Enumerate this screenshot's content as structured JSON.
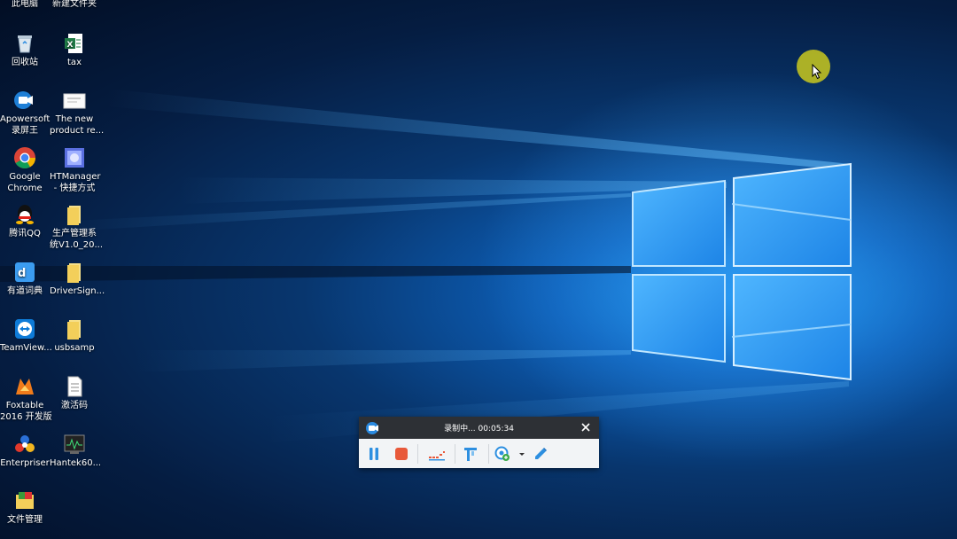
{
  "desktop": {
    "icons": [
      {
        "line1": "此电脑",
        "line2": "",
        "icon": "this-pc-icon"
      },
      {
        "line1": "新建文件夹",
        "line2": "",
        "icon": "folder-icon"
      },
      {
        "line1": "回收站",
        "line2": "",
        "icon": "recycle-bin-icon"
      },
      {
        "line1": "tax",
        "line2": "",
        "icon": "excel-file-icon"
      },
      {
        "line1": "Apowersoft",
        "line2": "录屏王",
        "icon": "apowersoft-icon"
      },
      {
        "line1": "The new",
        "line2": "product re...",
        "icon": "document-icon"
      },
      {
        "line1": "Google",
        "line2": "Chrome",
        "icon": "chrome-icon"
      },
      {
        "line1": "HTManager",
        "line2": "- 快捷方式",
        "icon": "htmanager-icon"
      },
      {
        "line1": "腾讯QQ",
        "line2": "",
        "icon": "qq-icon"
      },
      {
        "line1": "生产管理系",
        "line2": "统V1.0_20...",
        "icon": "folder-icon"
      },
      {
        "line1": "有道词典",
        "line2": "",
        "icon": "youdao-icon"
      },
      {
        "line1": "DriverSign...",
        "line2": "",
        "icon": "folder-icon"
      },
      {
        "line1": "TeamView...",
        "line2": "",
        "icon": "teamviewer-icon"
      },
      {
        "line1": "usbsamp",
        "line2": "",
        "icon": "folder-icon"
      },
      {
        "line1": "Foxtable",
        "line2": "2016 开发版",
        "icon": "foxtable-icon"
      },
      {
        "line1": "激活码",
        "line2": "",
        "icon": "text-file-icon"
      },
      {
        "line1": "Enterpriser",
        "line2": "",
        "icon": "enterpriser-icon"
      },
      {
        "line1": "Hantek60...",
        "line2": "",
        "icon": "hantek-icon"
      },
      {
        "line1": "文件管理",
        "line2": "",
        "icon": "file-manager-icon"
      }
    ]
  },
  "recorder": {
    "status": "录制中... 00:05:34",
    "buttons": [
      "pause-icon",
      "stop-icon",
      "audio-level-icon",
      "toolbox-icon",
      "webcam-icon",
      "dropdown-arrow-icon",
      "pen-icon"
    ]
  },
  "colors": {
    "accent": "#2d8fe0",
    "stop": "#e8593a",
    "recorder_title_bg": "#2d3035",
    "recorder_bar_bg": "#f2f4f6",
    "cursor_halo": "#c4c420"
  }
}
